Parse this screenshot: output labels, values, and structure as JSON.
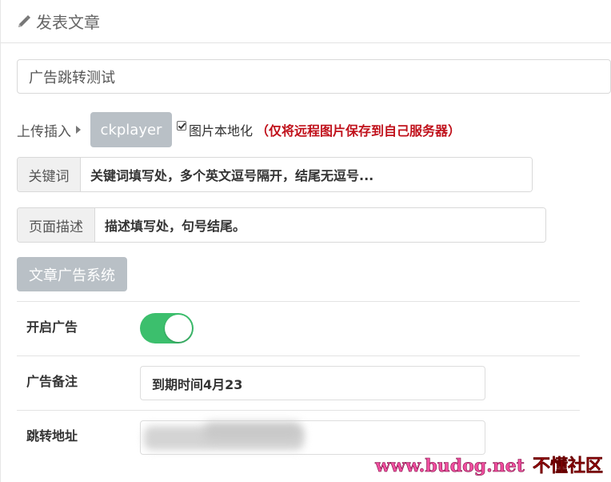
{
  "header": {
    "title": "发表文章",
    "icon": "pencil-icon"
  },
  "title_input": {
    "value": "广告跳转测试"
  },
  "upload": {
    "label": "上传插入",
    "ck_button": "ckplayer",
    "localize_label": "图片本地化",
    "localize_note": "（仅将远程图片保存到自己服务器）",
    "localize_checked": true
  },
  "keywords": {
    "addon": "关键词",
    "value": "关键词填写处，多个英文逗号隔开，结尾无逗号..."
  },
  "description": {
    "addon": "页面描述",
    "value": "描述填写处，句号结尾。"
  },
  "ad_system_button": "文章广告系统",
  "ad_settings": {
    "enable_label": "开启广告",
    "enable_on": true,
    "note_label": "广告备注",
    "note_value": "到期时间4月23",
    "redirect_label": "跳转地址"
  },
  "watermark": {
    "url": "www.budog.net",
    "name": "不懂社区"
  },
  "colors": {
    "toggle_on": "#3cbf6d",
    "button_gray": "#b9c0c6",
    "note_red": "#c0111b"
  }
}
